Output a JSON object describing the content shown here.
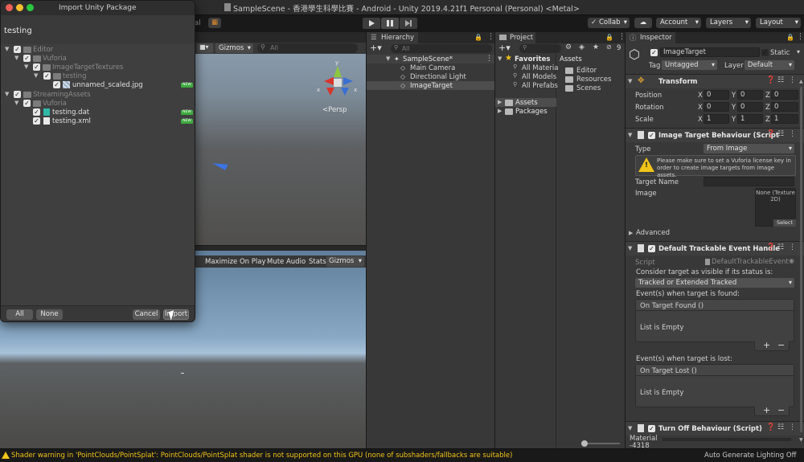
{
  "window": {
    "title": "SampleScene - 香港學生科學比賽 - Android - Unity 2019.4.21f1 Personal (Personal) <Metal>"
  },
  "toolbar": {
    "collab_label": "Collab",
    "account_label": "Account",
    "layers_label": "Layers",
    "layout_label": "Layout",
    "partial_tab_label": "al"
  },
  "scene_view": {
    "gizmos_label": "Gizmos",
    "search_placeholder": "All",
    "persp_label": "<Persp",
    "axis_x": "x",
    "axis_y": "y",
    "axis_x2": "x"
  },
  "game_view": {
    "maximize_label": "Maximize On Play",
    "mute_label": "Mute Audio",
    "stats_label": "Stats",
    "gizmos_label": "Gizmos"
  },
  "import_dialog": {
    "title": "Import Unity Package",
    "package_name": "testing",
    "tree": [
      {
        "label": "Editor"
      },
      {
        "label": "Vuforia"
      },
      {
        "label": "ImageTargetTextures"
      },
      {
        "label": "testing"
      },
      {
        "label": "unnamed_scaled.jpg",
        "badge": "NEW"
      },
      {
        "label": "StreamingAssets"
      },
      {
        "label": "Vuforia"
      },
      {
        "label": "testing.dat",
        "badge": "NEW"
      },
      {
        "label": "testing.xml",
        "badge": "NEW"
      }
    ],
    "all_label": "All",
    "none_label": "None",
    "cancel_label": "Cancel",
    "import_label": "Import"
  },
  "hierarchy": {
    "tab_label": "Hierarchy",
    "search_placeholder": "All",
    "scene_name": "SampleScene*",
    "items": [
      "Main Camera",
      "Directional Light",
      "ImageTarget"
    ]
  },
  "project": {
    "tab_label": "Project",
    "hidden_count": "9",
    "favorites_label": "Favorites",
    "favorites": [
      "All Materia",
      "All Models",
      "All Prefabs"
    ],
    "tree": [
      "Assets",
      "Packages"
    ],
    "assets_header": "Assets",
    "asset_folders": [
      "Editor",
      "Resources",
      "Scenes"
    ]
  },
  "inspector": {
    "tab_label": "Inspector",
    "object_name": "ImageTarget",
    "static_label": "Static",
    "tag_label": "Tag",
    "tag_value": "Untagged",
    "layer_label": "Layer",
    "layer_value": "Default",
    "transform": {
      "title": "Transform",
      "position_label": "Position",
      "rotation_label": "Rotation",
      "scale_label": "Scale",
      "position": [
        "0",
        "0",
        "0"
      ],
      "rotation": [
        "0",
        "0",
        "0"
      ],
      "scale": [
        "1",
        "1",
        "1"
      ],
      "x": "X",
      "y": "Y",
      "z": "Z"
    },
    "image_target": {
      "title": "Image Target Behaviour (Script",
      "type_label": "Type",
      "type_value": "From Image",
      "warning": "Please make sure to set a Vuforia license key in order to create image targets from image assets.",
      "target_name_label": "Target Name",
      "image_label": "Image",
      "image_value": "None (Texture 2D)",
      "select_label": "Select",
      "advanced_label": "Advanced"
    },
    "trackable_event": {
      "title": "Default Trackable Event Handle",
      "script_label": "Script",
      "script_value": "DefaultTrackableEvent",
      "consider_label": "Consider target as visible if its status is:",
      "status_value": "Tracked or Extended Tracked",
      "found_label": "Event(s) when target is found:",
      "found_event": "On Target Found ()",
      "found_empty": "List is Empty",
      "lost_label": "Event(s) when target is lost:",
      "lost_event": "On Target Lost ()",
      "lost_empty": "List is Empty"
    },
    "turn_off": {
      "title": "Turn Off Behaviour (Script)"
    },
    "material_label": "Material",
    "material_sub": "-4318"
  },
  "status_bar": {
    "warning": "Shader warning in 'PointClouds/PointSplat': PointClouds/PointSplat shader is not supported on this GPU (none of subshaders/fallbacks are suitable)",
    "right": "Auto Generate Lighting Off"
  }
}
